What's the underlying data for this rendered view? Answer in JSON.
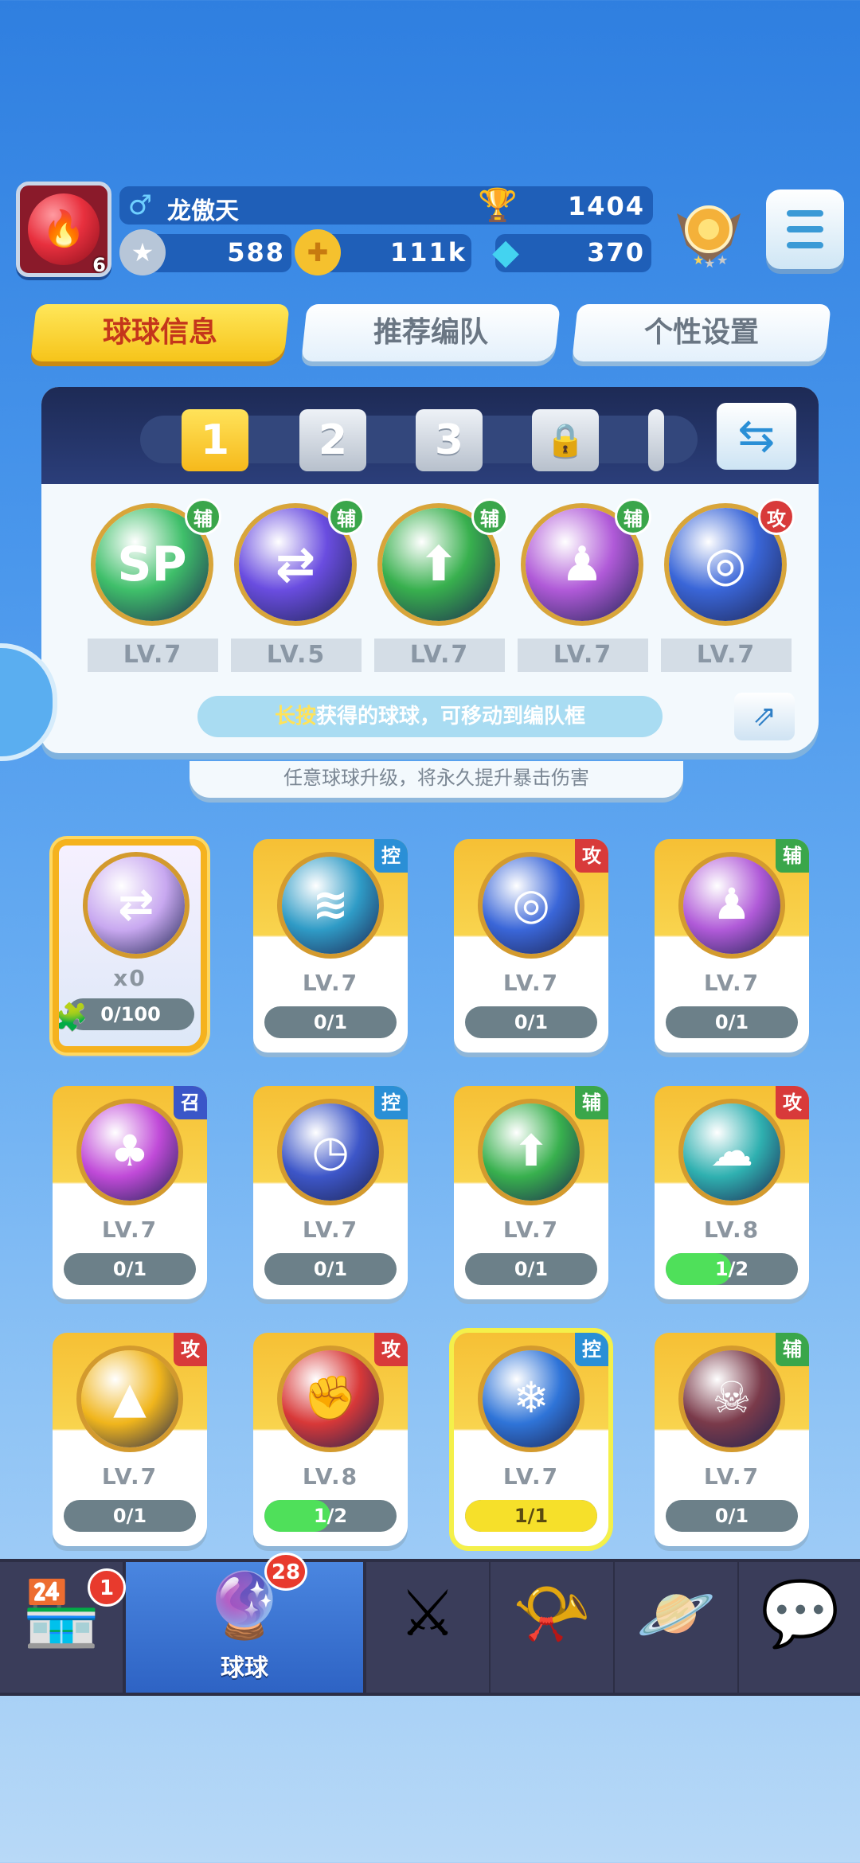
{
  "player": {
    "level": "6",
    "gender_symbol": "♂",
    "name": "龙傲天",
    "trophies": "1404",
    "currency1": "588",
    "currency2": "111k",
    "gems": "370"
  },
  "tabs": [
    {
      "label": "球球信息",
      "active": true
    },
    {
      "label": "推荐编队",
      "active": false
    },
    {
      "label": "个性设置",
      "active": false
    }
  ],
  "loadout": {
    "slots": [
      "1",
      "2",
      "3"
    ],
    "balls": [
      {
        "glyph": "SP",
        "tag": "辅",
        "level": "LV.7",
        "color": "#3fbf6a",
        "icon": "sp-heal-orb"
      },
      {
        "glyph": "⇄",
        "tag": "辅",
        "level": "LV.5",
        "color": "#6a4de0",
        "icon": "swap-orb"
      },
      {
        "glyph": "⬆",
        "tag": "辅",
        "level": "LV.7",
        "color": "#38b04e",
        "icon": "star-arrow-orb"
      },
      {
        "glyph": "♟",
        "tag": "辅",
        "level": "LV.7",
        "color": "#b05ad8",
        "icon": "clone-orb"
      },
      {
        "glyph": "◎",
        "tag": "攻",
        "level": "LV.7",
        "color": "#3a66d8",
        "icon": "vortex-orb"
      }
    ],
    "hint_highlight": "长按",
    "hint_rest": "获得的球球，可移动到编队框",
    "tip": "任意球球升级，将永久提升暴击伤害"
  },
  "grid": [
    {
      "special": true,
      "count": "x0",
      "progress_text": "0/100",
      "progress": 0,
      "color": "#c8a8f0",
      "glyph": "⇄",
      "icon": "rainbow-swap-orb"
    },
    {
      "tag": "控",
      "level": "LV.7",
      "progress_text": "0/1",
      "progress": 0,
      "color": "#2f9bc6",
      "glyph": "≋",
      "icon": "wind-orb"
    },
    {
      "tag": "攻",
      "level": "LV.7",
      "progress_text": "0/1",
      "progress": 0,
      "color": "#3a66d8",
      "glyph": "◎",
      "icon": "vortex-orb"
    },
    {
      "tag": "辅",
      "level": "LV.7",
      "progress_text": "0/1",
      "progress": 0,
      "color": "#b05ad8",
      "glyph": "♟",
      "icon": "clone-orb"
    },
    {
      "tag": "召",
      "level": "LV.7",
      "progress_text": "0/1",
      "progress": 0,
      "color": "#c04ad8",
      "glyph": "♣",
      "icon": "mushroom-orb"
    },
    {
      "tag": "控",
      "level": "LV.7",
      "progress_text": "0/1",
      "progress": 0,
      "color": "#3d56c8",
      "glyph": "◷",
      "icon": "clock-orb"
    },
    {
      "tag": "辅",
      "level": "LV.7",
      "progress_text": "0/1",
      "progress": 0,
      "color": "#38b04e",
      "glyph": "⬆",
      "icon": "star-arrow-orb"
    },
    {
      "tag": "攻",
      "level": "LV.8",
      "progress_text": "1/2",
      "progress": 0.5,
      "color": "#2fb0b0",
      "glyph": "☁",
      "icon": "tornado-orb"
    },
    {
      "tag": "攻",
      "level": "LV.7",
      "progress_text": "0/1",
      "progress": 0,
      "color": "#f0b51c",
      "glyph": "▲",
      "icon": "lightning-orb"
    },
    {
      "tag": "攻",
      "level": "LV.8",
      "progress_text": "1/2",
      "progress": 0.5,
      "color": "#d83838",
      "glyph": "✊",
      "icon": "fist-orb"
    },
    {
      "tag": "控",
      "level": "LV.7",
      "progress_text": "1/1",
      "progress": 1,
      "color": "#2f74d8",
      "glyph": "❄",
      "icon": "snowflake-orb",
      "glow": true
    },
    {
      "tag": "辅",
      "level": "LV.7",
      "progress_text": "0/1",
      "progress": 0,
      "color": "#7a3a4a",
      "glyph": "☠",
      "icon": "skull-orb"
    }
  ],
  "tag_colors": {
    "辅": "#3aa64a",
    "攻": "#d83a3a",
    "控": "#2a8fd6",
    "召": "#3a56c8"
  },
  "nav": {
    "shop_badge": "1",
    "balls_label": "球球",
    "balls_badge": "28"
  }
}
